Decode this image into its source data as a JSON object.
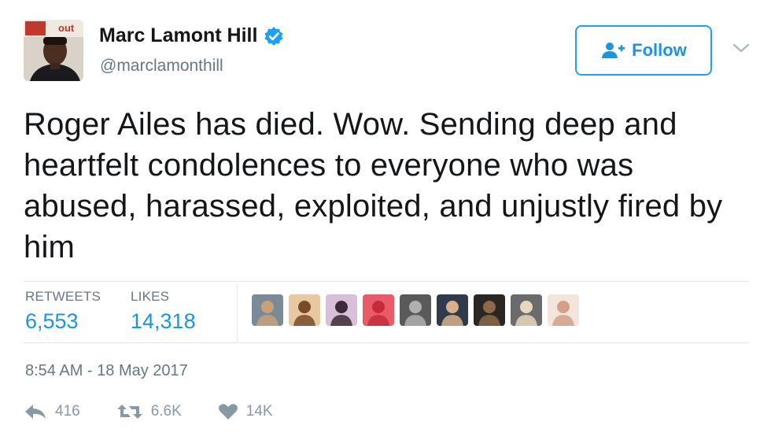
{
  "user": {
    "name": "Marc Lamont Hill",
    "handle": "@marclamonthill",
    "verified": true,
    "avatar_text": "out"
  },
  "follow_button": {
    "label": "Follow",
    "icon": "add-user-icon"
  },
  "tweet": {
    "text": "Roger Ailes has died. Wow. Sending deep and heartfelt condolences to everyone who was abused, harassed, exploited, and unjustly fired by him"
  },
  "stats": {
    "retweets_label": "RETWEETS",
    "retweets_value": "6,553",
    "likes_label": "LIKES",
    "likes_value": "14,318"
  },
  "likers": [
    {
      "name": "liker-avatar-1",
      "bg": "#7a8a98",
      "fg": "#c8a07a"
    },
    {
      "name": "liker-avatar-2",
      "bg": "#e6c9a0",
      "fg": "#7a4a2a"
    },
    {
      "name": "liker-avatar-3",
      "bg": "#d9c0d8",
      "fg": "#3b2a3a"
    },
    {
      "name": "liker-avatar-4",
      "bg": "#e85c6a",
      "fg": "#c42b3b"
    },
    {
      "name": "liker-avatar-5",
      "bg": "#5a5a5a",
      "fg": "#b0b0b0"
    },
    {
      "name": "liker-avatar-6",
      "bg": "#2f3a4a",
      "fg": "#d8b08c"
    },
    {
      "name": "liker-avatar-7",
      "bg": "#2a2622",
      "fg": "#8a6a4a"
    },
    {
      "name": "liker-avatar-8",
      "bg": "#6b6b6b",
      "fg": "#e8d6bf"
    },
    {
      "name": "liker-avatar-9",
      "bg": "#f2e6dc",
      "fg": "#d4a08a"
    }
  ],
  "timestamp": "8:54 AM - 18 May 2017",
  "actions": {
    "reply_count": "416",
    "retweet_count": "6.6K",
    "like_count": "14K"
  },
  "colors": {
    "accent": "#1da1f2",
    "link": "#1b95e0",
    "muted": "#657786",
    "icon": "#8899a6",
    "border": "#e1e8ed"
  }
}
